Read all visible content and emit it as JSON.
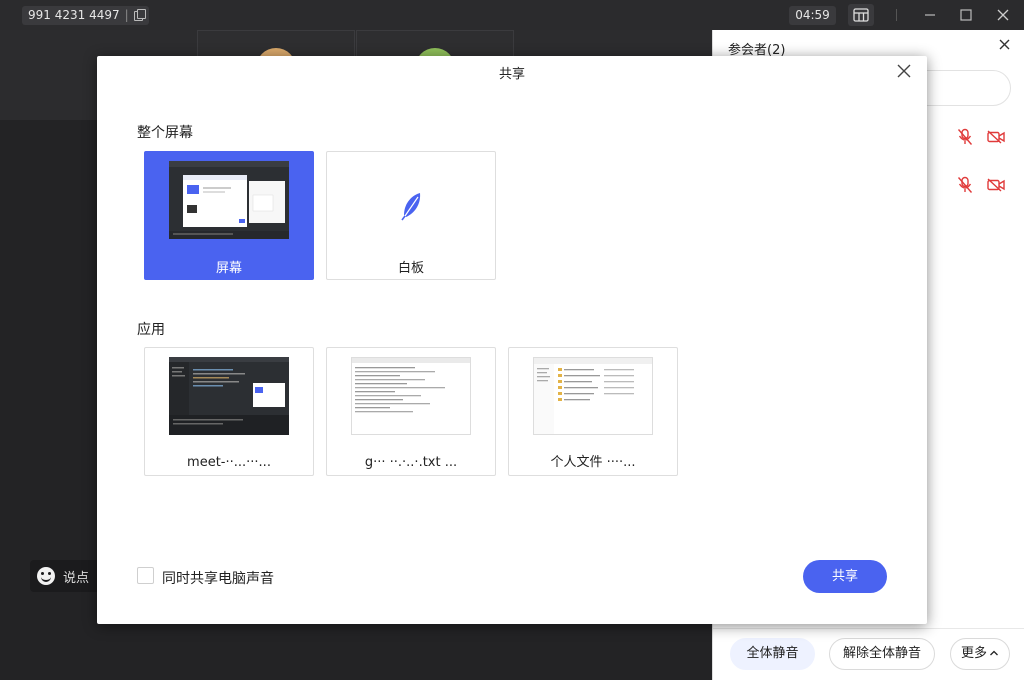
{
  "topbar": {
    "meeting_id": "991 4231 4497",
    "timer": "04:59"
  },
  "stage": {
    "chat_placeholder": "说点"
  },
  "participants": {
    "title": "参会者(2)",
    "count": 2,
    "mute_all": "全体静音",
    "unmute_all": "解除全体静音",
    "more": "更多"
  },
  "share_dialog": {
    "title": "共享",
    "section_screen": "整个屏幕",
    "screen_cards": [
      {
        "label": "屏幕",
        "selected": true
      },
      {
        "label": "白板",
        "selected": false
      }
    ],
    "section_apps": "应用",
    "app_cards": [
      {
        "label": "meet-··...···..."
      },
      {
        "label": "g··· ··.·..·.txt ..."
      },
      {
        "label": "个人文件 ····..."
      }
    ],
    "share_audio_label": "同时共享电脑声音",
    "share_audio_checked": false,
    "share_button": "共享"
  },
  "colors": {
    "accent": "#4a63f0",
    "mute_red": "#e03a3a",
    "dark_bg": "#2a2a2c"
  },
  "icons": {
    "copy": "copy-icon",
    "layout": "layout-icon",
    "close": "close-icon",
    "feather": "feather-icon",
    "mic_off": "mic-off-icon",
    "camera_off": "camera-off-icon",
    "chevron_up": "chevron-up-icon",
    "emoji": "emoji-icon"
  }
}
